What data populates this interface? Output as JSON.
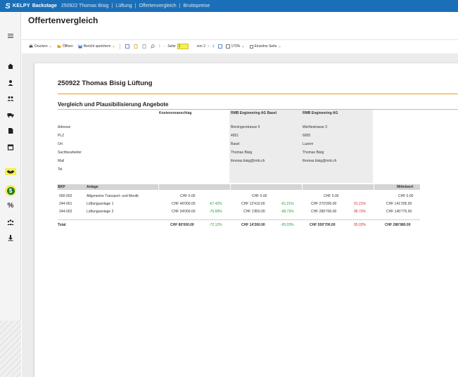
{
  "topbar": {
    "brand": "KELPY",
    "app": "Backstage",
    "crumbs": [
      "250922 Thomas Bisig",
      "Lüftung",
      "Offertenvergleich",
      "Bruttopreise"
    ]
  },
  "page": {
    "title": "Offertenvergleich"
  },
  "toolbar": {
    "print": "Drucken",
    "open": "Öffnen",
    "save_report": "Bericht speichern",
    "page_label": "Seite",
    "page_value": "1",
    "page_of": "von 2",
    "zoom": "170%",
    "single_page": "Einzelne Seite"
  },
  "sidebar": {
    "icons": [
      "menu-icon",
      "home-icon",
      "person-icon",
      "people-icon",
      "truck-icon",
      "document-icon",
      "calendar-icon",
      "handshake-icon",
      "dollar-icon",
      "percent-icon",
      "group-icon",
      "download-icon"
    ]
  },
  "report": {
    "title": "250922 Thomas Bisig Lüftung",
    "section": "Vergleich und Plausibilisierung Angebote",
    "columns": [
      "Kostenvoranschlag",
      "RMB Engineering AG Basel",
      "RMB Engineering AG"
    ],
    "address_labels": [
      "Adresse",
      "PLZ",
      "Ort",
      "Sachbearbeiter",
      "Mail",
      "Tel."
    ],
    "vendors": [
      {
        "address": "Binningerstrasse 5",
        "plz": "4051",
        "ort": "Basel",
        "contact": "Thomas Bisig",
        "mail": "thomas.bisig@rmb.ch"
      },
      {
        "address": "Werftestrasse 3",
        "plz": "6005",
        "ort": "Luzern",
        "contact": "Thomas Bisig",
        "mail": "thomas.bisig@rmb.ch"
      }
    ],
    "table": {
      "headers": {
        "bkp": "BKP",
        "anlage": "Anlage",
        "mittelwert": "Mittelwert"
      },
      "rows": [
        {
          "bkp": "000-002",
          "anlage": "Allgemeine Transport- und Montb",
          "kv": "CHF 0.00",
          "v1": "CHF 0.00",
          "v1p": "",
          "v2": "CHF 0.00",
          "v2p": "",
          "mw": "CHF 0.00"
        },
        {
          "bkp": "244-001",
          "anlage": "Lüftungsanlage 1",
          "kv": "CHF 46'000.00",
          "kvp": "-67.42%",
          "v1": "CHF 12'410.00",
          "v1p": "-91.21%",
          "v2": "CHF 270'000.00",
          "v2p": "91.21%",
          "mw": "CHF 141'205.00"
        },
        {
          "bkp": "244-002",
          "anlage": "Lüftungsanlage 2",
          "kv": "CHF 34'000.00",
          "kvp": "-76.68%",
          "v1": "CHF 1'850.00",
          "v1p": "-98.73%",
          "v2": "CHF 289'700.00",
          "v2p": "98.73%",
          "mw": "CHF 145'775.00"
        }
      ],
      "total": {
        "label": "Total",
        "kv": "CHF 80'000.00",
        "kvp": "-72.12%",
        "v1": "CHF 14'260.00",
        "v1p": "-95.03%",
        "v2": "CHF 559'700.00",
        "v2p": "95.03%",
        "mw": "CHF 286'980.00"
      }
    }
  }
}
